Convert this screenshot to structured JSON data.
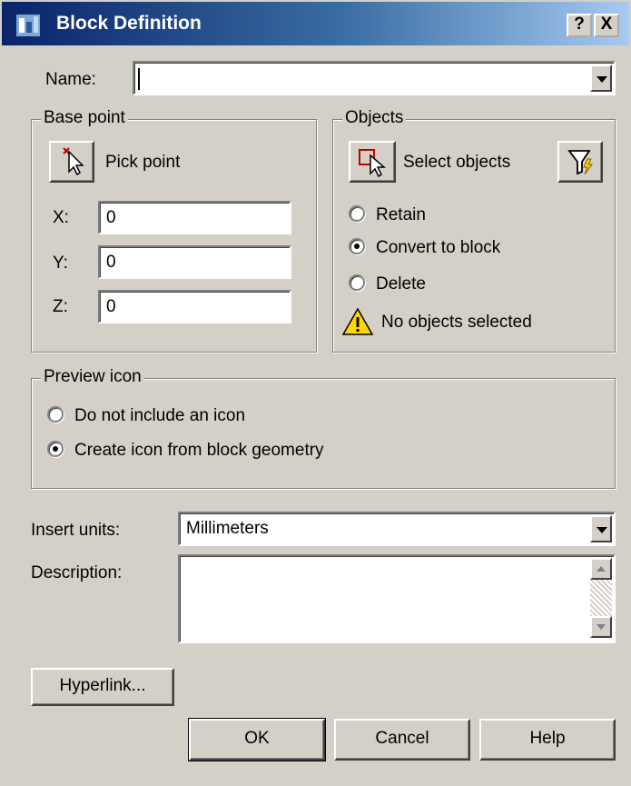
{
  "window": {
    "title": "Block Definition",
    "help_label": "?",
    "close_label": "X"
  },
  "name": {
    "label": "Name:",
    "value": ""
  },
  "base_point": {
    "title": "Base point",
    "pick_label": "Pick point",
    "x_label": "X:",
    "x_value": "0",
    "y_label": "Y:",
    "y_value": "0",
    "z_label": "Z:",
    "z_value": "0"
  },
  "objects": {
    "title": "Objects",
    "select_label": "Select objects",
    "retain_label": "Retain",
    "convert_label": "Convert to block",
    "delete_label": "Delete",
    "selected_option": "convert",
    "status_text": "No objects selected"
  },
  "preview": {
    "title": "Preview icon",
    "no_icon_label": "Do not include an icon",
    "create_icon_label": "Create icon from block geometry",
    "selected_option": "create"
  },
  "insert_units": {
    "label": "Insert units:",
    "value": "Millimeters"
  },
  "description": {
    "label": "Description:",
    "value": ""
  },
  "buttons": {
    "hyperlink": "Hyperlink...",
    "ok": "OK",
    "cancel": "Cancel",
    "help": "Help"
  },
  "colors": {
    "title_start": "#0a246a",
    "title_end": "#a6caf0",
    "face": "#d4d0c8",
    "warning": "#ffd800"
  }
}
